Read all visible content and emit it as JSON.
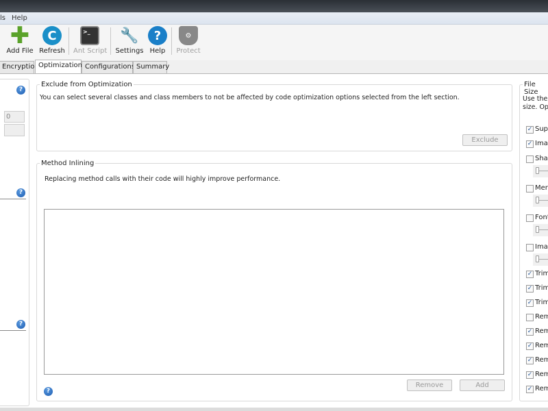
{
  "menu": [
    "ls",
    "Help"
  ],
  "toolbar": [
    {
      "label": "Add File",
      "icon": "plus-icon",
      "enabled": true
    },
    {
      "label": "Refresh",
      "icon": "refresh-icon",
      "enabled": true
    },
    {
      "label": "Ant Script",
      "icon": "terminal-icon",
      "enabled": false
    },
    {
      "label": "Settings",
      "icon": "wrench-icon",
      "enabled": true
    },
    {
      "label": "Help",
      "icon": "help-icon",
      "enabled": true
    },
    {
      "label": "Protect",
      "icon": "shield-icon",
      "enabled": false
    }
  ],
  "tabs": [
    {
      "label": "Encryption"
    },
    {
      "label": "Optimization",
      "active": true
    },
    {
      "label": "Configurations"
    },
    {
      "label": "Summary"
    }
  ],
  "left": {
    "field_value": "0"
  },
  "exclude": {
    "title": "Exclude from Optimization",
    "desc": "You can select several classes and class members to not be affected by code optimization options selected from the left section.",
    "exclude_btn": "Exclude"
  },
  "inlining": {
    "title": "Method Inlining",
    "desc": "Replacing method calls with their code will highly improve performance.",
    "remove_btn": "Remove",
    "add_btn": "Add"
  },
  "filesize": {
    "title": "File Size",
    "desc1": "Use the f",
    "desc2": "size. Opt",
    "items": [
      {
        "label": "Supe",
        "checked": true
      },
      {
        "label": "Imag",
        "checked": true
      },
      {
        "label": "Shap",
        "checked": false,
        "slider": true
      },
      {
        "label": "Merg",
        "checked": false,
        "slider": true
      },
      {
        "label": "Font",
        "checked": false,
        "slider": true
      },
      {
        "label": "Imag",
        "checked": false,
        "slider": true
      },
      {
        "label": "Trim",
        "checked": true
      },
      {
        "label": "Trim",
        "checked": true
      },
      {
        "label": "Trim",
        "checked": true
      },
      {
        "label": "Rem",
        "checked": false
      },
      {
        "label": "Rem",
        "checked": true
      },
      {
        "label": "Rem",
        "checked": true
      },
      {
        "label": "Rem",
        "checked": true
      },
      {
        "label": "Rem",
        "checked": true
      },
      {
        "label": "Rem",
        "checked": true
      }
    ]
  },
  "colors": {
    "accent": "#1b5bb0"
  }
}
